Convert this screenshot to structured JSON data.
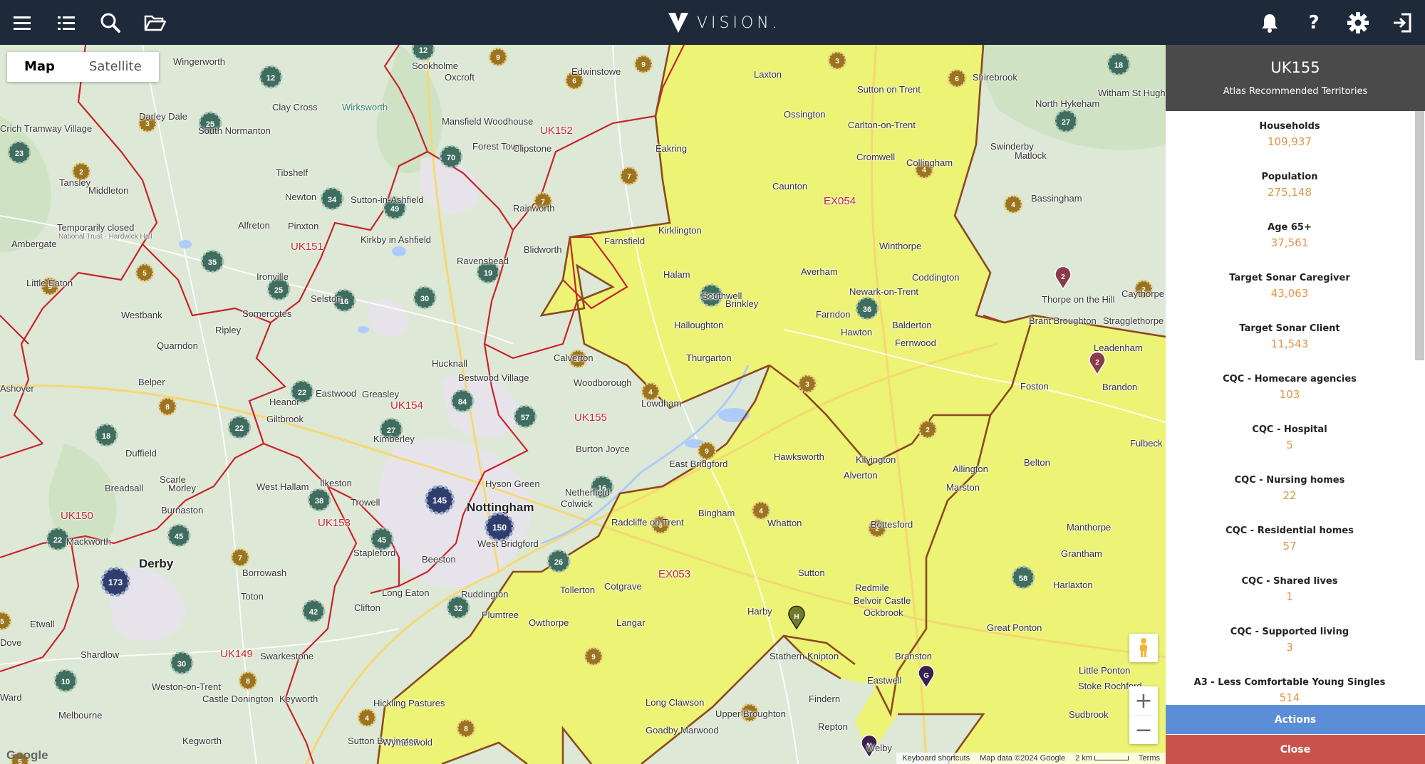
{
  "topbar": {
    "brand": "VISION.",
    "icons": [
      "menu-icon",
      "list-icon",
      "search-icon",
      "folder-open-icon",
      "bell-icon",
      "help-icon",
      "gear-icon",
      "logout-icon"
    ]
  },
  "map": {
    "map_type": {
      "map": "Map",
      "satellite": "Satellite"
    },
    "attribution": {
      "shortcuts": "Keyboard shortcuts",
      "data": "Map data ©2024 Google",
      "scale": "2 km",
      "terms": "Terms"
    },
    "google": "Google",
    "territories": [
      "UK152",
      "UK151",
      "UK154",
      "UK155",
      "UK150",
      "UK153",
      "UK149",
      "EX054",
      "EX053"
    ],
    "cities": [
      "Nottingham",
      "Derby"
    ],
    "towns": [
      "Wingerworth",
      "Mansfield Woodhouse",
      "Forest Town",
      "Clipstone",
      "Edwinstowe",
      "Laxton",
      "Sutton on Trent",
      "Ossington",
      "Carlton-on-Trent",
      "Tibshelf",
      "Newton",
      "Sutton-in-Ashfield",
      "Rainworth",
      "Kirklington",
      "Eakring",
      "Caunton",
      "Cromwell",
      "Collingham",
      "Swinderby",
      "Bassingham",
      "Alfreton",
      "Kirkby in Ashfield",
      "Blidworth",
      "Farnsfield",
      "Ravenshead",
      "Halam",
      "Southwell",
      "Averham",
      "Winthorpe",
      "Coddington",
      "Newark-on-Trent",
      "Ripley",
      "Somercotes",
      "Selston",
      "Hucknall",
      "Calverton",
      "Thurgarton",
      "Lowdham",
      "Farndon",
      "Hawton",
      "Balderton",
      "Fernwood",
      "Brinkley",
      "Halloughton",
      "Belper",
      "Heanor",
      "Eastwood",
      "Greasley",
      "Bestwood Village",
      "Woodborough",
      "Kimberley",
      "Giltbrook",
      "Burton Joyce",
      "East Bridgford",
      "Hawksworth",
      "Kilvington",
      "Alverton",
      "Duffield",
      "Morley",
      "West Hallam",
      "Ilkeston",
      "Trowell",
      "Hyson Green",
      "Netherfield",
      "Colwick",
      "Radcliffe on Trent",
      "Bingham",
      "Whatton",
      "Bottesford",
      "Mackworth",
      "Stapleford",
      "Beeston",
      "West Bridgford",
      "Tollerton",
      "Cotgrave",
      "Sutton",
      "Redmile",
      "Belvoir Castle",
      "Ockbrook",
      "Borrowash",
      "Toton",
      "Long Eaton",
      "Clifton",
      "Ruddington",
      "Plumtree",
      "Owthorpe",
      "Langar",
      "Harby",
      "Stathern",
      "Knipton",
      "Branston",
      "Eastwell",
      "Findern",
      "Shardlow",
      "Swarkestone",
      "Weston-on-Trent",
      "Castle Donington",
      "Keyworth",
      "Hickling Pastures",
      "Long Clawson",
      "Upper Broughton",
      "Goadby Marwood",
      "Repton",
      "Melbourne",
      "Kegworth",
      "Sutton Bonington",
      "Wymeswold",
      "Welby",
      "Caythorpe",
      "Brandon",
      "Foston",
      "Allington",
      "Marston",
      "Belton",
      "Manthorpe",
      "Grantham",
      "Harlaxton",
      "Great Ponton",
      "Little Ponton",
      "Stoke Rochford",
      "Sudbrook",
      "Fulbeck",
      "Leadenham",
      "Stragglethorpe",
      "Brant Broughton",
      "Thorpe on the Hill",
      "North Hykeham",
      "Witham St Hughs",
      "Matlock",
      "Tansley",
      "Middleton",
      "Ambergate",
      "Westbank",
      "Quarndon",
      "Breadsall",
      "Burnaston",
      "Etwall",
      "Dove",
      "Ward",
      "Ashover",
      "Darley Dale",
      "Crich Tramway Village",
      "Temporarily closed",
      "National Trust - Hardwick Hall",
      "Wirksworth",
      "Little Eaton",
      "Scarle",
      "Shirebrook",
      "Sookholme",
      "Oxcroft",
      "Clay Cross",
      "South Normanton",
      "Pinxton",
      "Ironville"
    ]
  },
  "panel": {
    "title": "UK155",
    "subtitle": "Atlas Recommended Territories",
    "stats": [
      {
        "label": "Households",
        "value": "109,937"
      },
      {
        "label": "Population",
        "value": "275,148"
      },
      {
        "label": "Age 65+",
        "value": "37,561"
      },
      {
        "label": "Target Sonar Caregiver",
        "value": "43,063"
      },
      {
        "label": "Target Sonar Client",
        "value": "11,543"
      },
      {
        "label": "CQC - Homecare agencies",
        "value": "103"
      },
      {
        "label": "CQC - Hospital",
        "value": "5"
      },
      {
        "label": "CQC - Nursing homes",
        "value": "22"
      },
      {
        "label": "CQC - Residential homes",
        "value": "57"
      },
      {
        "label": "CQC - Shared lives",
        "value": "1"
      },
      {
        "label": "CQC - Supported living",
        "value": "3"
      },
      {
        "label": "A3 - Less Comfortable Young Singles",
        "value": "514"
      }
    ],
    "actions": "Actions",
    "close": "Close"
  },
  "colors": {
    "topbar": "#1e2a3a",
    "territory_highlight": "#f1f57a",
    "territory_border": "#c8242b",
    "cluster_green": "#3f6d5f",
    "cluster_gold": "#9c7420",
    "cluster_navy": "#2f3e6e",
    "stat_value": "#e09545",
    "actions_button": "#5b8ed6",
    "close_button": "#c9534c"
  }
}
